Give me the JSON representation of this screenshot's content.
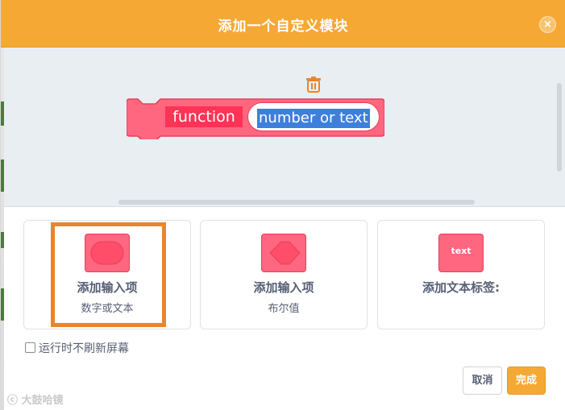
{
  "dialog": {
    "title": "添加一个自定义模块",
    "close_symbol": "×"
  },
  "workspace": {
    "block": {
      "label": "function",
      "input_text": "number or text"
    }
  },
  "options": [
    {
      "title": "添加输入项",
      "subtitle": "数字或文本",
      "icon": "rounded-input-shape-icon"
    },
    {
      "title": "添加输入项",
      "subtitle": "布尔值",
      "icon": "hexagon-input-shape-icon"
    },
    {
      "title": "添加文本标签:",
      "subtitle": "",
      "icon": "text-label-icon",
      "icon_text": "text"
    }
  ],
  "checkbox": {
    "label": "运行时不刷新屏幕",
    "checked": false
  },
  "buttons": {
    "cancel": "取消",
    "ok": "完成"
  },
  "watermark": "大鼓哈镜",
  "colors": {
    "header": "#f5a934",
    "block": "#ff6680",
    "highlight": "#e8852f",
    "selection": "#3e7fdc"
  }
}
